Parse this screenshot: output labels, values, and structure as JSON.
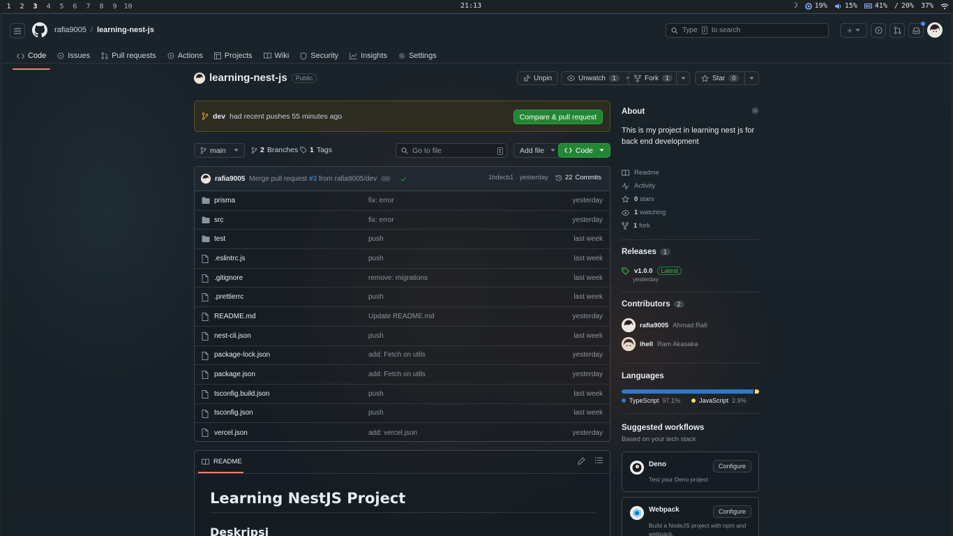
{
  "wm": {
    "workspaces": [
      "1",
      "2",
      "3",
      "4",
      "5",
      "6",
      "7",
      "8",
      "9",
      "10"
    ],
    "clock": "21:13",
    "status": {
      "moon": "☽",
      "cpu": "19%",
      "volume": "15%",
      "mem": "41%",
      "disk_label": "/",
      "disk": "20%",
      "battery": "37%"
    }
  },
  "nav": {
    "owner": "rafia9005",
    "separator": "/",
    "repo": "learning-nest-js",
    "search_placeholder": "Type",
    "search_kbd": "/",
    "search_suffix": "to search",
    "plus": "+"
  },
  "tabs": [
    {
      "label": "Code",
      "icon": "code-icon"
    },
    {
      "label": "Issues",
      "icon": "issue-icon"
    },
    {
      "label": "Pull requests",
      "icon": "pull-request-icon"
    },
    {
      "label": "Actions",
      "icon": "play-icon"
    },
    {
      "label": "Projects",
      "icon": "table-icon"
    },
    {
      "label": "Wiki",
      "icon": "book-icon"
    },
    {
      "label": "Security",
      "icon": "shield-icon"
    },
    {
      "label": "Insights",
      "icon": "graph-icon"
    },
    {
      "label": "Settings",
      "icon": "gear-icon"
    }
  ],
  "repo": {
    "name": "learning-nest-js",
    "visibility": "Public",
    "unpin": "Unpin",
    "unwatch": "Unwatch",
    "watch_count": "1",
    "fork": "Fork",
    "fork_count": "1",
    "star": "Star",
    "star_count": "0"
  },
  "notice": {
    "branch": "dev",
    "text": "had recent pushes 55 minutes ago",
    "button": "Compare & pull request"
  },
  "toolbar": {
    "branch": "main",
    "branches_count": "2",
    "branches_label": "Branches",
    "tags_count": "1",
    "tags_label": "Tags",
    "goto_placeholder": "Go to file",
    "goto_kbd": "t",
    "add_file": "Add file",
    "code": "Code"
  },
  "commit": {
    "author": "rafia9005",
    "message_prefix": "Merge pull request",
    "pr": "#3",
    "message_suffix": "from rafia9005/dev",
    "hash": "1bdecb1",
    "dot": "·",
    "time": "yesterday",
    "commits_count": "22",
    "commits_label": "Commits"
  },
  "files": [
    {
      "type": "dir",
      "name": "prisma",
      "msg": "fix: error",
      "time": "yesterday"
    },
    {
      "type": "dir",
      "name": "src",
      "msg": "fix: error",
      "time": "yesterday"
    },
    {
      "type": "dir",
      "name": "test",
      "msg": "push",
      "time": "last week"
    },
    {
      "type": "file",
      "name": ".eslintrc.js",
      "msg": "push",
      "time": "last week"
    },
    {
      "type": "file",
      "name": ".gitignore",
      "msg": "remove: migrations",
      "time": "last week"
    },
    {
      "type": "file",
      "name": ".prettierrc",
      "msg": "push",
      "time": "last week"
    },
    {
      "type": "file",
      "name": "README.md",
      "msg": "Update README.md",
      "time": "yesterday"
    },
    {
      "type": "file",
      "name": "nest-cli.json",
      "msg": "push",
      "time": "last week"
    },
    {
      "type": "file",
      "name": "package-lock.json",
      "msg": "add: Fetch on utils",
      "time": "yesterday"
    },
    {
      "type": "file",
      "name": "package.json",
      "msg": "add: Fetch on utils",
      "time": "yesterday"
    },
    {
      "type": "file",
      "name": "tsconfig.build.json",
      "msg": "push",
      "time": "last week"
    },
    {
      "type": "file",
      "name": "tsconfig.json",
      "msg": "push",
      "time": "last week"
    },
    {
      "type": "file",
      "name": "vercel.json",
      "msg": "add: vercel.json",
      "time": "yesterday"
    }
  ],
  "readme": {
    "tab": "README",
    "h1": "Learning NestJS Project",
    "h2": "Deskripsi"
  },
  "about": {
    "title": "About",
    "description": "This is my project in learning nest js for back end development",
    "readme": "Readme",
    "activity": "Activity",
    "stars_count": "0",
    "stars_label": "stars",
    "watching_count": "1",
    "watching_label": "watching",
    "fork_count": "1",
    "fork_label": "fork"
  },
  "releases": {
    "title": "Releases",
    "count": "1",
    "version": "v1.0.0",
    "badge": "Latest",
    "time": "yesterday"
  },
  "contributors": {
    "title": "Contributors",
    "count": "2",
    "list": [
      {
        "login": "rafia9005",
        "name": "Ahmad Rafi"
      },
      {
        "login": "ihell",
        "name": "Ram Akasaka"
      }
    ]
  },
  "languages": {
    "title": "Languages",
    "items": [
      {
        "name": "TypeScript",
        "percent": "97.1%",
        "value": 97.1,
        "color": "#3178c6"
      },
      {
        "name": "JavaScript",
        "percent": "2.9%",
        "value": 2.9,
        "color": "#f1e05a"
      }
    ]
  },
  "workflows": {
    "title": "Suggested workflows",
    "subtitle": "Based on your tech stack",
    "items": [
      {
        "name": "Deno",
        "desc": "Test your Deno project",
        "button": "Configure"
      },
      {
        "name": "Webpack",
        "desc": "Build a NodeJS project with npm and webpack.",
        "button": "Configure"
      }
    ]
  },
  "colors": {
    "accent_green": "#238636",
    "tab_underline": "#f78166",
    "link_blue": "#4493f8"
  }
}
